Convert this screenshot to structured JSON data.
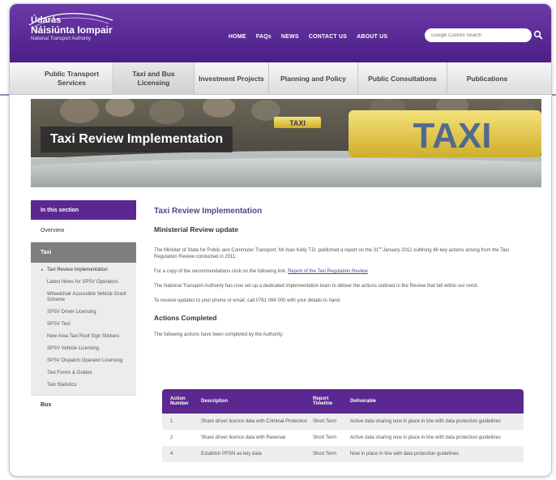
{
  "logo": {
    "line1": "Údarás",
    "line2": "Náisiúnta Iompair",
    "line3": "National Transport Authority"
  },
  "topnav": [
    "HOME",
    "FAQs",
    "NEWS",
    "CONTACT US",
    "ABOUT US"
  ],
  "search": {
    "placeholder": "Google Custom Search"
  },
  "mainnav": [
    {
      "label": "Public Transport Services"
    },
    {
      "label": "Taxi and Bus Licensing"
    },
    {
      "label": "Investment Projects"
    },
    {
      "label": "Planning and Policy"
    },
    {
      "label": "Public Consultations"
    },
    {
      "label": "Publications"
    }
  ],
  "banner": {
    "title": "Taxi Review Implementation",
    "sign_taxi": "TAXI",
    "sign_small": "TAXI"
  },
  "sidebar": {
    "heading": "In this section",
    "overview": "Overview",
    "taxi": "Taxi",
    "subitems": [
      "Taxi Review Implementation",
      "Latest News for SPSV Operators",
      "Wheelchair Accessible Vehicle Grant Scheme",
      "SPSV Driver Licensing",
      "SPSV Test",
      "New Area Taxi Roof Sign Stickers",
      "SPSV Vehicle Licensing",
      "SPSV Dispatch Operator Licensing",
      "Taxi Forms & Guides",
      "Taxi Statistics"
    ],
    "bus": "Bus"
  },
  "content": {
    "title": "Taxi Review Implementation",
    "subtitle": "Ministerial Review update",
    "para1_a": "The Minister of State for Public and Commuter Transport, Mr Alan Kelly T.D. published a report on the 31",
    "para1_sup": "st",
    "para1_b": " January 2012 outlining 46 key actions arising from the Taxi Regulation Review conducted in 2011.",
    "para2_prefix": "For a copy of the recommendations click on the following link:",
    "para2_link": "Report of the Taxi Regulation Review",
    "para3": "The National Transport Authority has now set up a dedicated implementation team to deliver the actions outlined in the Review that fall within our remit.",
    "para4": "To receive updates to your phone or email, call 0761 064 000 with your details to hand.",
    "actions_heading": "Actions Completed",
    "actions_intro": "The following actions have been completed by the Authority:",
    "table": {
      "headers": [
        "Action Number",
        "Description",
        "Report Timeline",
        "Deliverable"
      ],
      "rows": [
        [
          "1",
          "Share driver licence data with Criminal Protection",
          "Short Term",
          "Active data sharing now in place in line with data protection guidelines"
        ],
        [
          "2",
          "Share driver licence data with Revenue",
          "Short Term",
          "Active data sharing now in place in line with data protection guidelines"
        ],
        [
          "4",
          "Establish PPSN as key data",
          "Short Term",
          "Now in place in line with data protection guidelines"
        ]
      ]
    }
  }
}
